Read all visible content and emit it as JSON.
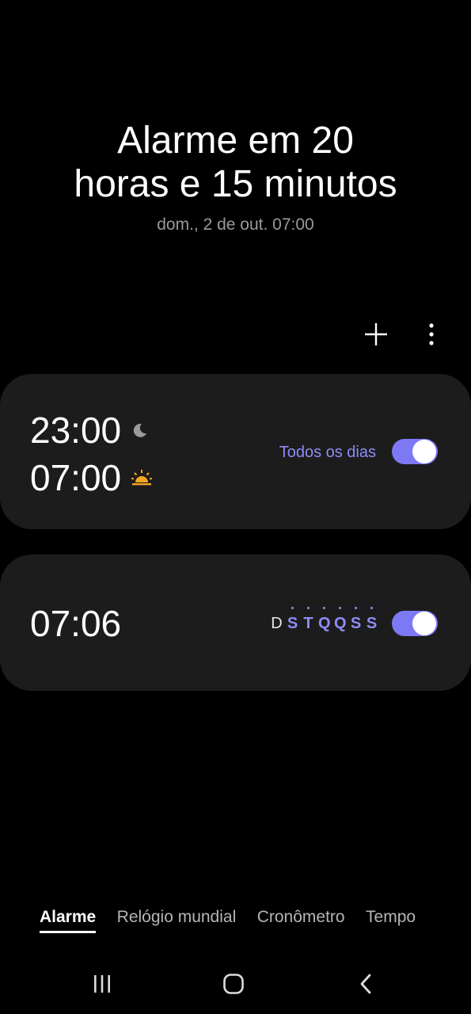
{
  "header": {
    "title_line1": "Alarme em 20",
    "title_line2": "horas e 15 minutos",
    "subtitle": "dom., 2 de out. 07:00"
  },
  "toolbar": {
    "add_icon": "plus-icon",
    "more_icon": "more-vertical-icon"
  },
  "alarms": [
    {
      "bedtime": "23:00",
      "bedtime_icon": "moon-icon",
      "wakeup": "07:00",
      "wakeup_icon": "sunrise-icon",
      "repeat": "Todos os dias",
      "enabled": true
    },
    {
      "time": "07:06",
      "days": [
        "D",
        "S",
        "T",
        "Q",
        "Q",
        "S",
        "S"
      ],
      "days_active": [
        false,
        true,
        true,
        true,
        true,
        true,
        true
      ],
      "enabled": true
    }
  ],
  "tabs": [
    "Alarme",
    "Relógio mundial",
    "Cronômetro",
    "Tempo"
  ],
  "active_tab": "Alarme",
  "colors": {
    "accent": "#8f8cf7",
    "toggle_on": "#7d79f4",
    "card_bg": "#1c1c1c",
    "sun": "#f5a623",
    "moon": "#9a9a9a"
  },
  "navbar": {
    "recent_icon": "recent-apps-icon",
    "home_icon": "home-icon",
    "back_icon": "back-icon"
  }
}
